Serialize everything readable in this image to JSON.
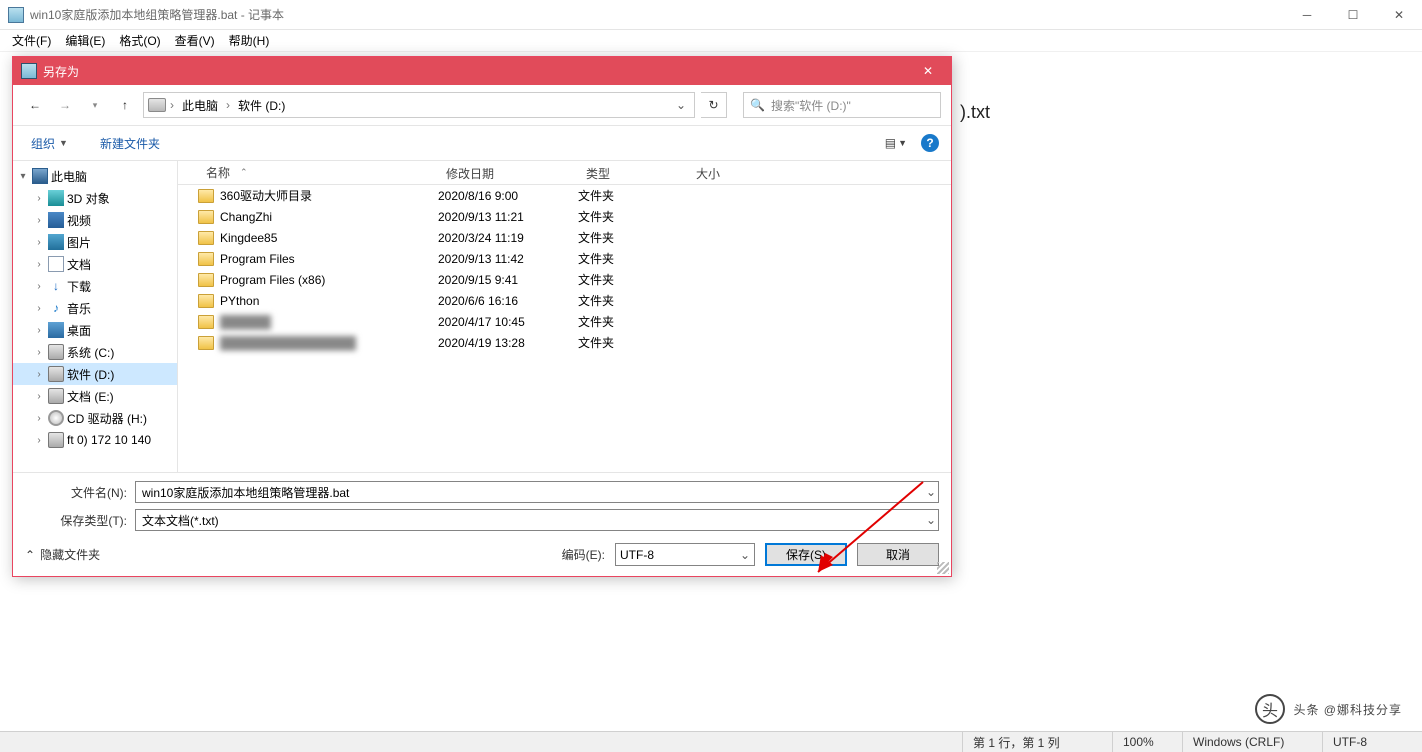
{
  "notepad": {
    "title": "win10家庭版添加本地组策略管理器.bat - 记事本",
    "menu": [
      "文件(F)",
      "编辑(E)",
      "格式(O)",
      "查看(V)",
      "帮助(H)"
    ],
    "content_fragment": ").txt",
    "status": {
      "pos": "第 1 行，第 1 列",
      "zoom": "100%",
      "eol": "Windows (CRLF)",
      "enc": "UTF-8"
    }
  },
  "dialog": {
    "title": "另存为",
    "breadcrumb": {
      "root": "此电脑",
      "node": "软件 (D:)"
    },
    "search_placeholder": "搜索\"软件 (D:)\"",
    "toolbar": {
      "organize": "组织",
      "newfolder": "新建文件夹"
    },
    "columns": {
      "name": "名称",
      "date": "修改日期",
      "type": "类型",
      "size": "大小"
    },
    "tree": [
      {
        "label": "此电脑",
        "icon": "pc",
        "depth": 0,
        "twist": "▾",
        "sel": false
      },
      {
        "label": "3D 对象",
        "icon": "cube",
        "depth": 1,
        "twist": "›"
      },
      {
        "label": "视频",
        "icon": "vid",
        "depth": 1,
        "twist": "›"
      },
      {
        "label": "图片",
        "icon": "pic",
        "depth": 1,
        "twist": "›"
      },
      {
        "label": "文档",
        "icon": "doc",
        "depth": 1,
        "twist": "›"
      },
      {
        "label": "下载",
        "icon": "dl",
        "depth": 1,
        "twist": "›"
      },
      {
        "label": "音乐",
        "icon": "mus",
        "depth": 1,
        "twist": "›"
      },
      {
        "label": "桌面",
        "icon": "desk",
        "depth": 1,
        "twist": "›"
      },
      {
        "label": "系统 (C:)",
        "icon": "drv",
        "depth": 1,
        "twist": "›"
      },
      {
        "label": "软件 (D:)",
        "icon": "drv",
        "depth": 1,
        "twist": "›",
        "sel": true
      },
      {
        "label": "文档 (E:)",
        "icon": "drv",
        "depth": 1,
        "twist": "›"
      },
      {
        "label": "CD 驱动器 (H:)",
        "icon": "cd",
        "depth": 1,
        "twist": "›"
      },
      {
        "label": "ft 0) 172 10 140",
        "icon": "drv",
        "depth": 1,
        "twist": "›"
      }
    ],
    "files": [
      {
        "name": "360驱动大师目录",
        "date": "2020/8/16 9:00",
        "type": "文件夹"
      },
      {
        "name": "ChangZhi",
        "date": "2020/9/13 11:21",
        "type": "文件夹"
      },
      {
        "name": "Kingdee85",
        "date": "2020/3/24 11:19",
        "type": "文件夹"
      },
      {
        "name": "Program Files",
        "date": "2020/9/13 11:42",
        "type": "文件夹"
      },
      {
        "name": "Program Files (x86)",
        "date": "2020/9/15 9:41",
        "type": "文件夹"
      },
      {
        "name": "PYthon",
        "date": "2020/6/6 16:16",
        "type": "文件夹"
      },
      {
        "name": "██████",
        "date": "2020/4/17 10:45",
        "type": "文件夹",
        "blur": true
      },
      {
        "name": "████████████████",
        "date": "2020/4/19 13:28",
        "type": "文件夹",
        "blur": true
      }
    ],
    "filename_label": "文件名(N):",
    "filetype_label": "保存类型(T):",
    "filename_value": "win10家庭版添加本地组策略管理器.bat",
    "filetype_value": "文本文档(*.txt)",
    "encoding_label": "编码(E):",
    "encoding_value": "UTF-8",
    "save_btn": "保存(S)",
    "cancel_btn": "取消",
    "hide_folders": "隐藏文件夹"
  },
  "watermark": "头条 @娜科技分享"
}
